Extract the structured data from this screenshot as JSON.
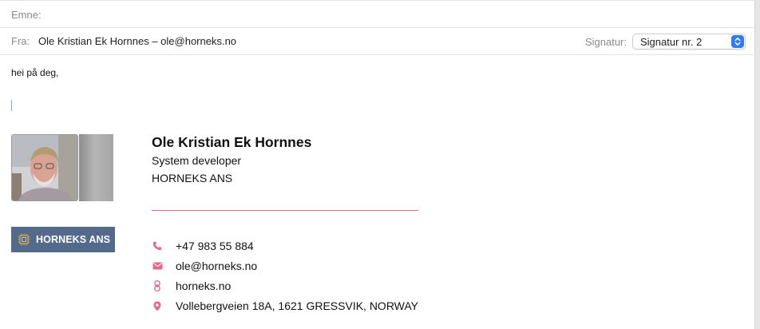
{
  "header": {
    "subject_label": "Emne:",
    "subject_value": "",
    "from_label": "Fra:",
    "from_value": "Ole Kristian Ek Hornnes – ole@horneks.no",
    "signature_label": "Signatur:",
    "signature_selected": "Signatur nr. 2"
  },
  "body": {
    "text": "hei på deg,"
  },
  "signature": {
    "name": "Ole Kristian Ek Hornnes",
    "title": "System developer",
    "company": "HORNEKS ANS",
    "logo_text": "HORNEKS ANS",
    "divider_color": "#e86a8a",
    "icon_color": "#e8688a",
    "contacts": {
      "phone": {
        "icon": "phone-icon",
        "value": "+47 983 55 884"
      },
      "email": {
        "icon": "mail-icon",
        "value": "ole@horneks.no"
      },
      "website": {
        "icon": "link-icon",
        "value": "horneks.no"
      },
      "address": {
        "icon": "location-pin-icon",
        "value": "Vollebergveien 18A, 1621 GRESSVIK, NORWAY"
      }
    }
  },
  "colors": {
    "accent": "#2f7bf6",
    "logo_background": "#536a8c"
  }
}
